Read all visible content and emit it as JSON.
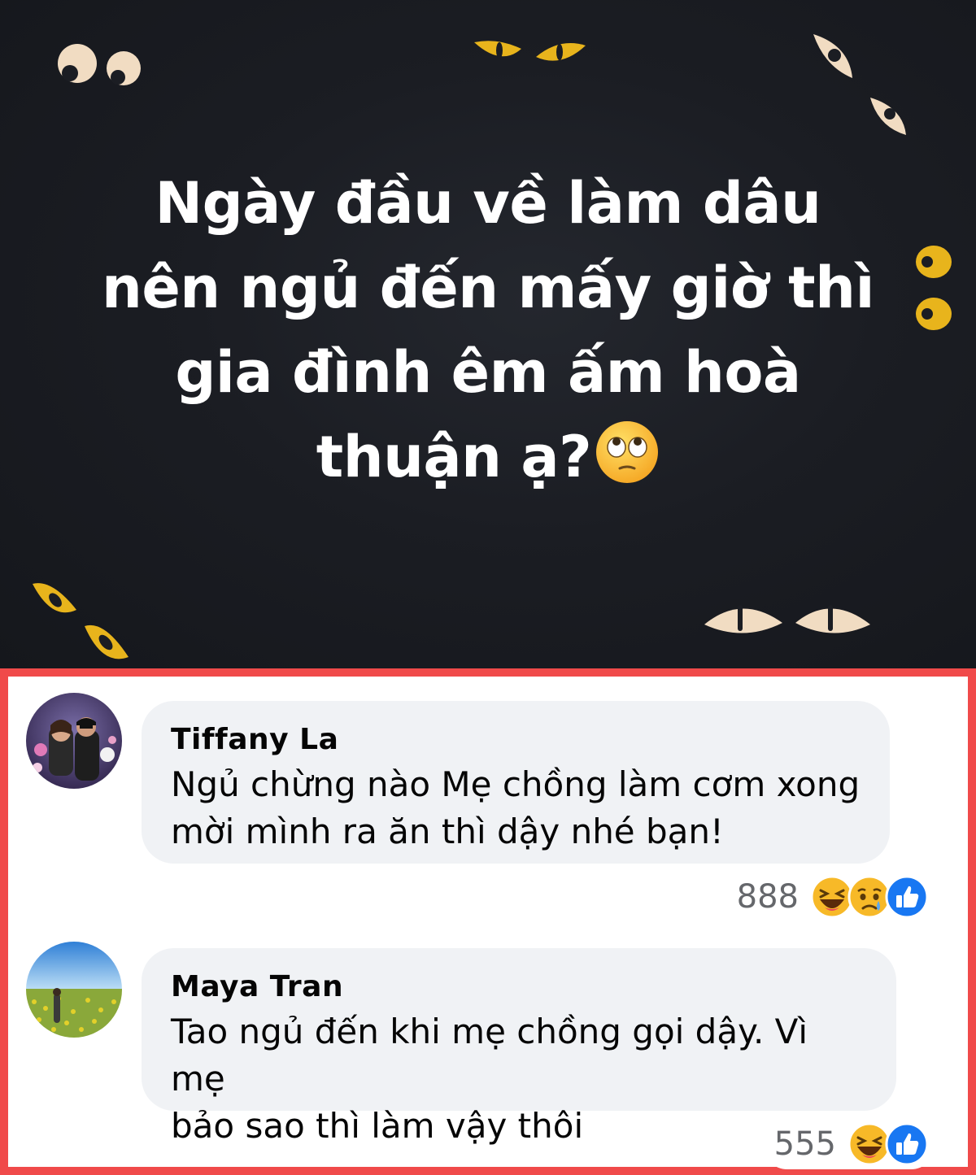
{
  "post": {
    "lines": [
      "Ngày đầu về làm dâu",
      "nên ngủ đến mấy giờ thì",
      "gia đình êm ấm hoà",
      "thuận ạ?"
    ],
    "emoji": "face-with-rolling-eyes-icon",
    "background_color": "#1b1d23",
    "text_color": "#ffffff"
  },
  "comments": [
    {
      "author": "Tiffany La",
      "line1": "Ngủ chừng nào Mẹ chồng làm cơm xong",
      "line2": "mời mình ra ăn thì dậy nhé bạn!",
      "reaction_count": "888",
      "reactions": [
        "haha-icon",
        "sad-icon",
        "like-icon"
      ]
    },
    {
      "author": "Maya Tran",
      "line1": "Tao ngủ đến khi mẹ chồng gọi dậy. Vì mẹ",
      "line2": "bảo sao thì làm vậy thôi",
      "reaction_count": "555",
      "reactions": [
        "haha-icon",
        "like-icon"
      ]
    }
  ],
  "colors": {
    "highlight_border": "#f04a4a",
    "bubble": "#f0f2f5",
    "like_blue": "#1877f2",
    "reaction_yellow": "#f7b928"
  }
}
